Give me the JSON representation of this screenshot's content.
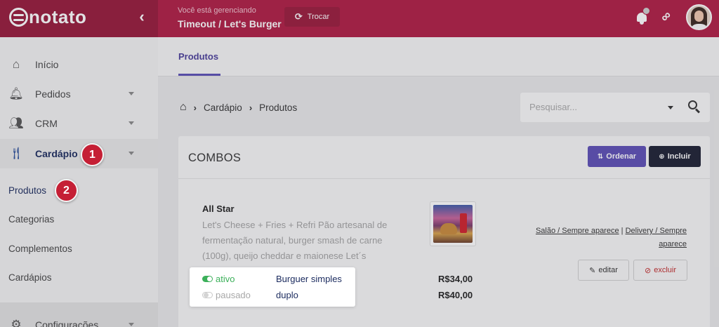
{
  "brand": {
    "name": "notato"
  },
  "header": {
    "managing_caption": "Você está gerenciando",
    "managing_name": "Timeout / Let's Burger",
    "swap_label": "Trocar"
  },
  "sidebar": {
    "items": [
      {
        "label": "Início",
        "icon": "home-icon",
        "caret": false
      },
      {
        "label": "Pedidos",
        "icon": "bell-icon",
        "caret": true
      },
      {
        "label": "CRM",
        "icon": "users-icon",
        "caret": true
      },
      {
        "label": "Cardápio",
        "icon": "utensils-icon",
        "caret": true
      },
      {
        "label": "Configurações",
        "icon": "gear-icon",
        "caret": true
      }
    ],
    "submenu": [
      "Produtos",
      "Categorias",
      "Complementos",
      "Cardápios"
    ]
  },
  "steps": [
    "1",
    "2"
  ],
  "main": {
    "tab": "Produtos",
    "breadcrumb": [
      "Cardápio",
      "Produtos"
    ],
    "search_placeholder": "Pesquisar..."
  },
  "card": {
    "title": "COMBOS",
    "order_label": "Ordenar",
    "add_label": "Incluir",
    "product": {
      "name": "All Star",
      "description": "Let's Cheese + Fries + Refri Pão artesanal de fermentação natural, burger smash de carne (100g), queijo cheddar e maionese Let´s",
      "channel_1": "Salão / Sempre aparece",
      "channel_sep": " | ",
      "channel_2": "Delivery / Sempre aparece",
      "edit_label": "editar",
      "delete_label": "excluir",
      "variants": [
        {
          "status": "ativo",
          "name": "Burguer simples",
          "price": "R$34,00",
          "active": true
        },
        {
          "status": "pausado",
          "name": "duplo",
          "price": "R$40,00",
          "active": false
        }
      ]
    }
  },
  "colors": {
    "topbar": "#b01c43",
    "brand_bg": "#97193a",
    "accent": "#5c4eb5",
    "dark_button": "#1c1f33",
    "step_badge": "#c51f35",
    "active_green": "#3cb05a"
  }
}
